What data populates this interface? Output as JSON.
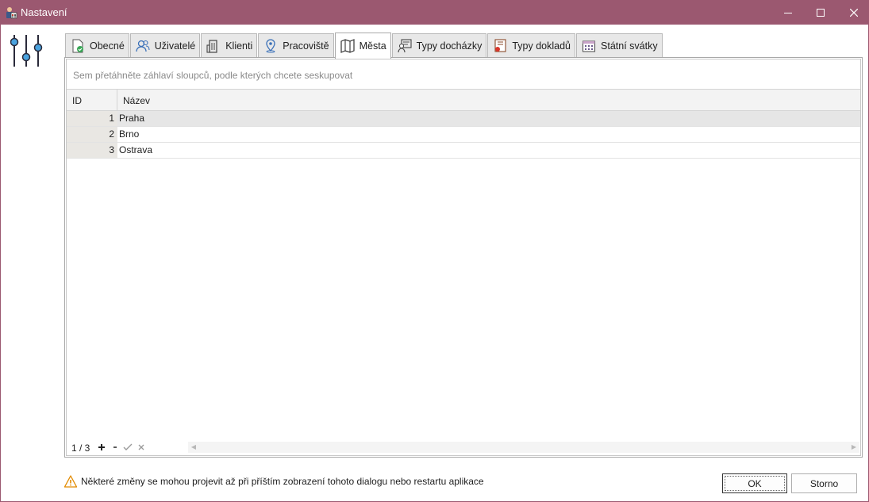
{
  "window": {
    "title": "Nastavení",
    "accent_color": "#9b5870"
  },
  "tabs": [
    {
      "label": "Obecné",
      "icon": "document-check-icon",
      "active": false
    },
    {
      "label": "Uživatelé",
      "icon": "users-icon",
      "active": false
    },
    {
      "label": "Klienti",
      "icon": "building-icon",
      "active": false
    },
    {
      "label": "Pracoviště",
      "icon": "location-pin-icon",
      "active": false
    },
    {
      "label": "Města",
      "icon": "map-icon",
      "active": true
    },
    {
      "label": "Typy docházky",
      "icon": "attendance-icon",
      "active": false
    },
    {
      "label": "Typy dokladů",
      "icon": "document-stamp-icon",
      "active": false
    },
    {
      "label": "Státní svátky",
      "icon": "calendar-icon",
      "active": false
    }
  ],
  "grid": {
    "group_panel_text": "Sem přetáhněte záhlaví sloupců, podle kterých chcete seskupovat",
    "columns": [
      "ID",
      "Název"
    ],
    "rows": [
      {
        "id": "1",
        "name": "Praha"
      },
      {
        "id": "2",
        "name": "Brno"
      },
      {
        "id": "3",
        "name": "Ostrava"
      }
    ],
    "navigator": {
      "position": "1 / 3"
    }
  },
  "footer": {
    "warning": "Některé změny se mohou projevit až při příštím zobrazení tohoto dialogu nebo restartu aplikace",
    "ok_label": "OK",
    "cancel_label": "Storno"
  }
}
